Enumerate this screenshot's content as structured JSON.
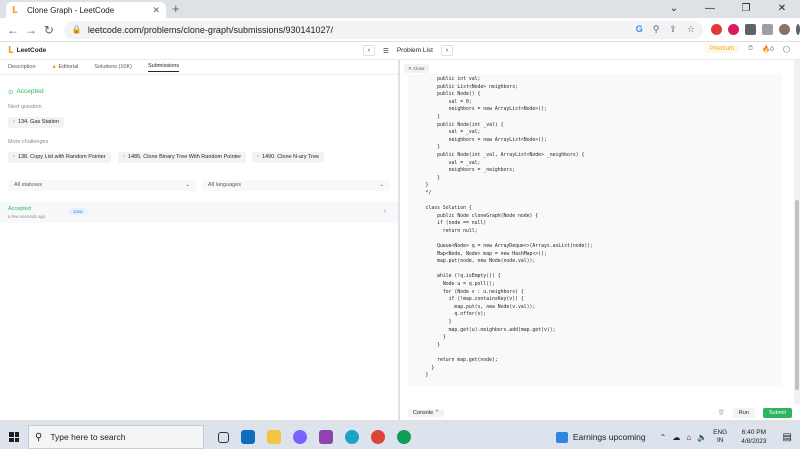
{
  "browser": {
    "tab_title": "Clone Graph - LeetCode",
    "url": "leetcode.com/problems/clone-graph/submissions/930141027/"
  },
  "header": {
    "logo": "LeetCode",
    "problem_list": "Problem List",
    "premium": "Premium",
    "streak": "0"
  },
  "left": {
    "tabs": [
      "Description",
      "Editorial",
      "Solutions (10K)",
      "Submissions"
    ],
    "status": "Accepted",
    "next_question_label": "Next question",
    "next_question": "134. Gas Station",
    "more_challenges_label": "More challenges",
    "challenges": [
      "138. Copy List with Random Pointer",
      "1485. Clone Binary Tree With Random Pointer",
      "1490. Clone N-ary Tree"
    ],
    "filter_status": "All statuses",
    "filter_lang": "All languages",
    "submission": {
      "status": "Accepted",
      "date": "a few seconds ago",
      "lang": "Java"
    }
  },
  "right": {
    "close_label": "Close",
    "code": "        public int val;\n        public List<Node> neighbors;\n        public Node() {\n            val = 0;\n            neighbors = new ArrayList<Node>();\n        }\n        public Node(int _val) {\n            val = _val;\n            neighbors = new ArrayList<Node>();\n        }\n        public Node(int _val, ArrayList<Node> _neighbors) {\n            val = _val;\n            neighbors = _neighbors;\n        }\n    }\n    */\n\n    class Solution {\n        public Node cloneGraph(Node node) {\n        if (node == null)\n          return null;\n\n        Queue<Node> q = new ArrayDeque<>(Arrays.asList(node));\n        Map<Node, Node> map = new HashMap<>();\n        map.put(node, new Node(node.val));\n\n        while (!q.isEmpty()) {\n          Node u = q.poll();\n          for (Node v : u.neighbors) {\n            if (!map.containsKey(v)) {\n              map.put(v, new Node(v.val));\n              q.offer(v);\n            }\n            map.get(u).neighbors.add(map.get(v));\n          }\n        }\n\n        return map.get(node);\n      }\n    }",
    "console": "Console",
    "run": "Run",
    "submit": "Submit"
  },
  "taskbar": {
    "search_placeholder": "Type here to search",
    "news": "Earnings upcoming",
    "lang": "ENG",
    "region": "IN",
    "time": "6:40 PM",
    "date": "4/8/2023"
  },
  "colors": {
    "accent_green": "#2db55d",
    "brand_orange": "#f89f1b"
  }
}
